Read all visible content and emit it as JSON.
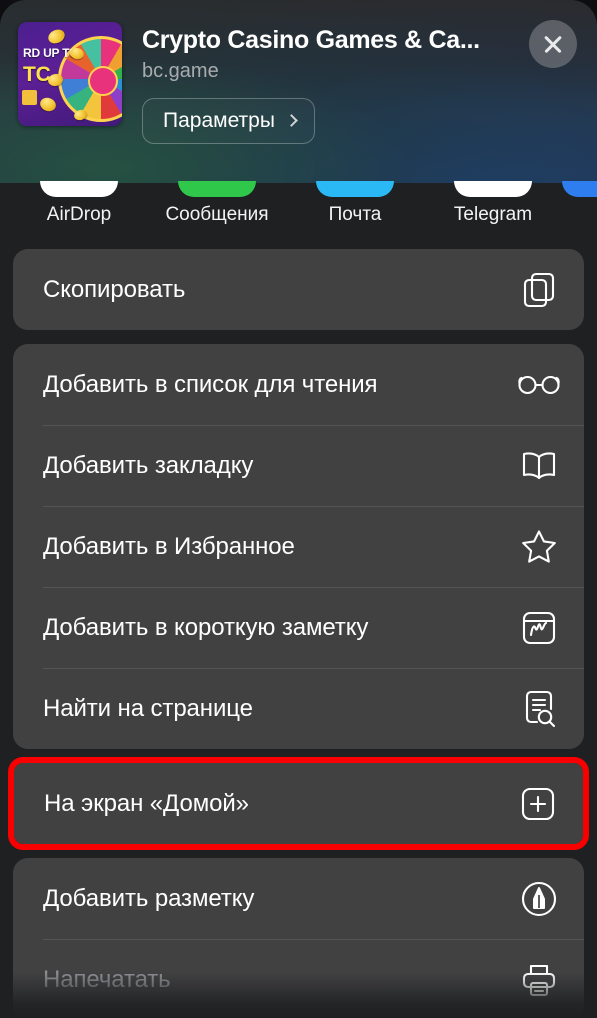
{
  "header": {
    "app_title": "Crypto Casino Games & Ca...",
    "domain_label": "bc.game",
    "options_button": "Параметры",
    "close_icon": "close-icon",
    "chevron_icon": "chevron-right-icon",
    "thumb_line1": "RD UP TO",
    "thumb_line2": "TC",
    "gradient_start": "#2a2b2e",
    "gradient_end": "#26384b"
  },
  "share_targets": [
    {
      "label": "AirDrop",
      "color": "#ffffff"
    },
    {
      "label": "Сообщения",
      "color": "#2fc84a"
    },
    {
      "label": "Почта",
      "color": "#2ab9f4"
    },
    {
      "label": "Telegram",
      "color": "#ffffff"
    },
    {
      "label": "",
      "color": "#2f7ef0"
    }
  ],
  "groups": [
    {
      "name": "copy-group",
      "highlight": false,
      "rows": [
        {
          "label": "Скопировать",
          "icon": "copy-icon",
          "dim": false
        }
      ]
    },
    {
      "name": "safari-actions-group",
      "highlight": false,
      "rows": [
        {
          "label": "Добавить в список для чтения",
          "icon": "glasses-icon",
          "dim": false
        },
        {
          "label": "Добавить закладку",
          "icon": "book-icon",
          "dim": false
        },
        {
          "label": "Добавить в Избранное",
          "icon": "star-icon",
          "dim": false
        },
        {
          "label": "Добавить в короткую заметку",
          "icon": "quick-note-icon",
          "dim": false
        },
        {
          "label": "Найти на странице",
          "icon": "find-on-page-icon",
          "dim": false
        }
      ]
    },
    {
      "name": "home-screen-group",
      "highlight": true,
      "highlight_color": "#f80000",
      "rows": [
        {
          "label": "На экран «Домой»",
          "icon": "plus-square-icon",
          "dim": false
        }
      ]
    },
    {
      "name": "markup-print-group",
      "highlight": false,
      "rows": [
        {
          "label": "Добавить разметку",
          "icon": "markup-pen-icon",
          "dim": false
        },
        {
          "label": "Напечатать",
          "icon": "printer-icon",
          "dim": true
        }
      ]
    }
  ],
  "theme": {
    "page_background": "#1f2022",
    "card_background": "#414142",
    "text_primary": "#ffffff",
    "text_secondary": "#a8acaf"
  }
}
